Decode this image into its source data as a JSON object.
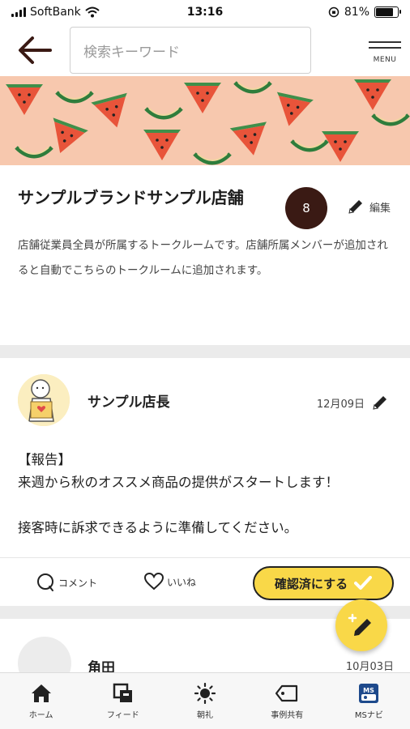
{
  "status_bar": {
    "carrier": "SoftBank",
    "time": "13:16",
    "battery_percent": "81%",
    "battery_level": 0.81
  },
  "header": {
    "search_placeholder": "検索キーワード",
    "menu_label": "MENU"
  },
  "room": {
    "title": "サンプルブランドサンプル店舗",
    "member_count": "8",
    "edit_label": "編集",
    "description": "店舗従業員全員が所属するトークルームです。店舗所属メンバーが追加されると自動でこちらのトークルームに追加されます。"
  },
  "post": {
    "author": "サンプル店長",
    "date": "12月09日",
    "body_lines": [
      "【報告】",
      "来週から秋のオススメ商品の提供がスタートします！",
      "",
      "接客時に訴求できるように準備してください。"
    ],
    "comment_label": "コメント",
    "like_label": "いいね",
    "confirm_label": "確認済にする"
  },
  "post2": {
    "author": "角田",
    "date": "10月03日"
  },
  "bottom_nav": [
    {
      "label": "ホーム",
      "icon": "home-icon"
    },
    {
      "label": "フィード",
      "icon": "feed-icon"
    },
    {
      "label": "朝礼",
      "icon": "sun-icon"
    },
    {
      "label": "事例共有",
      "icon": "tag-icon"
    },
    {
      "label": "MSナビ",
      "icon": "ms-navi-icon"
    }
  ],
  "colors": {
    "accent_yellow": "#f9d848",
    "badge_brown": "#3a1a14",
    "banner_peach": "#f7c8ae"
  }
}
